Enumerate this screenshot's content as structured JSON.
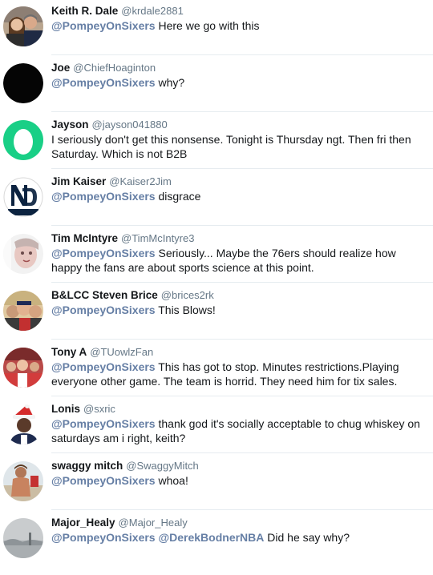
{
  "tweets": [
    {
      "name": "Keith R. Dale",
      "handle": "@krdale2881",
      "mentions": [
        "@PompeyOnSixers"
      ],
      "text": "Here we go with this",
      "avatar_icon": "couple-photo-avatar"
    },
    {
      "name": "Joe",
      "handle": "@ChiefHoaginton",
      "mentions": [
        "@PompeyOnSixers"
      ],
      "text": "why?",
      "avatar_icon": "black-circle-avatar"
    },
    {
      "name": "Jayson",
      "handle": "@jayson041880",
      "mentions": [],
      "text": "I seriously don't get this nonsense. Tonight is Thursday ngt. Then fri then Saturday. Which is not B2B",
      "avatar_icon": "default-egg-avatar"
    },
    {
      "name": "Jim Kaiser",
      "handle": "@Kaiser2Jim",
      "mentions": [
        "@PompeyOnSixers"
      ],
      "text": "disgrace",
      "avatar_icon": "notre-dame-logo-avatar"
    },
    {
      "name": "Tim McIntyre",
      "handle": "@TimMcIntyre3",
      "mentions": [
        "@PompeyOnSixers"
      ],
      "text": "Seriously... Maybe the 76ers should realize how happy the fans are about sports science at this point.",
      "avatar_icon": "portrait-avatar"
    },
    {
      "name": "B&LCC Steven Brice",
      "handle": "@brices2rk",
      "mentions": [
        "@PompeyOnSixers"
      ],
      "text": "This Blows!",
      "avatar_icon": "group-photo-avatar"
    },
    {
      "name": "Tony A",
      "handle": "@TUowlzFan",
      "mentions": [
        "@PompeyOnSixers"
      ],
      "text": "This has got to stop.  Minutes restrictions.Playing everyone other game.  The team is horrid. They need him for tix sales.",
      "avatar_icon": "crowd-photo-avatar"
    },
    {
      "name": "Lonis",
      "handle": "@sxric",
      "mentions": [
        "@PompeyOnSixers"
      ],
      "text": "thank god it's socially acceptable to chug whiskey on saturdays am i right, keith?",
      "avatar_icon": "santa-hat-avatar"
    },
    {
      "name": "swaggy mitch",
      "handle": "@SwaggyMitch",
      "mentions": [
        "@PompeyOnSixers"
      ],
      "text": "whoa!",
      "avatar_icon": "beach-photo-avatar"
    },
    {
      "name": "Major_Healy",
      "handle": "@Major_Healy",
      "mentions": [
        "@PompeyOnSixers",
        "@DerekBodnerNBA"
      ],
      "text": "Did he say why?",
      "avatar_icon": "misty-landscape-avatar"
    }
  ],
  "colors": {
    "mention": "#667fa5",
    "name": "#14171a",
    "handle": "#657786",
    "divider": "#e6ecf0",
    "egg_green": "#19cf86"
  }
}
